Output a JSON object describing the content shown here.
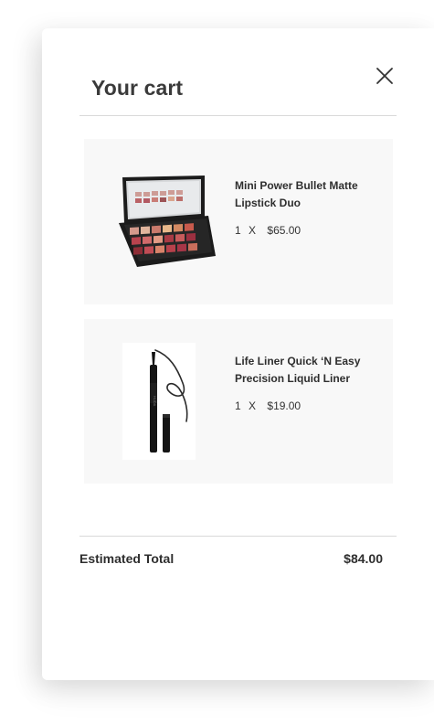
{
  "cart": {
    "title": "Your cart",
    "close_icon": "close-icon",
    "items": [
      {
        "name": "Mini Power Bullet Matte Lipstick Duo",
        "quantity": "1",
        "times": "X",
        "price": "$65.00",
        "image_icon": "eyeshadow-palette-image"
      },
      {
        "name": "Life Liner Quick ‘N Easy Precision Liquid Liner",
        "quantity": "1",
        "times": "X",
        "price": "$19.00",
        "image_icon": "liquid-eyeliner-image"
      }
    ],
    "total": {
      "label": "Estimated Total",
      "value": "$84.00"
    }
  }
}
